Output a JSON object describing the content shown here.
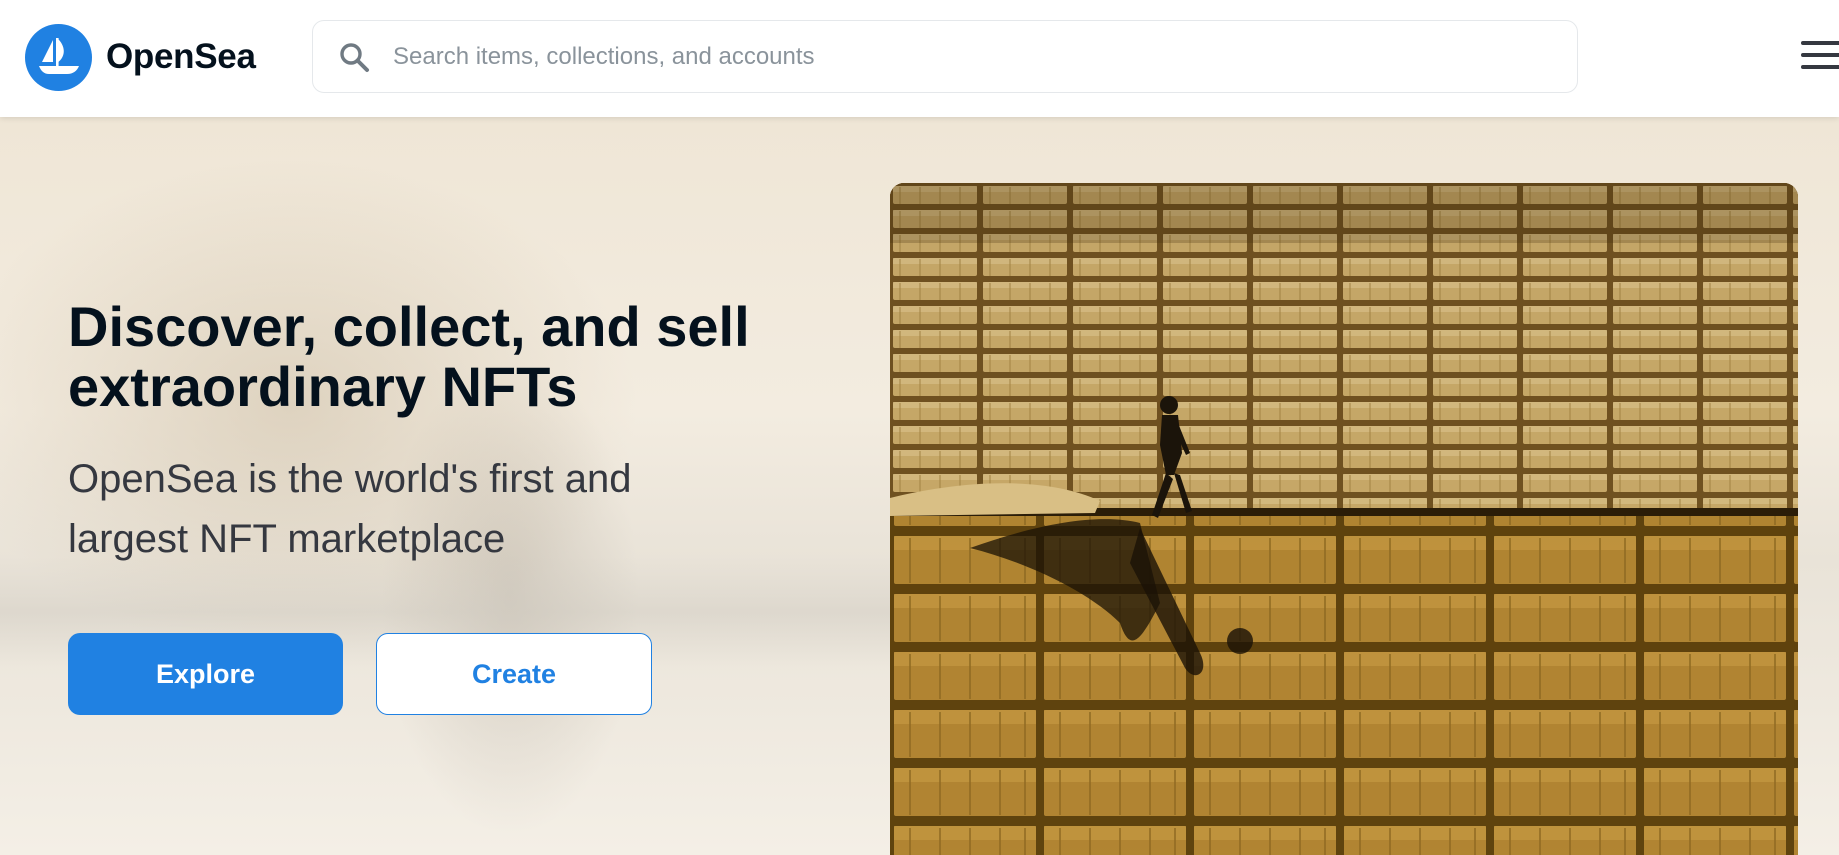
{
  "header": {
    "brand_name": "OpenSea",
    "search_placeholder": "Search items, collections, and accounts"
  },
  "hero": {
    "headline_line1": "Discover, collect, and sell",
    "headline_line2": "extraordinary NFTs",
    "subline_line1": "OpenSea is the world's first and",
    "subline_line2": "largest NFT marketplace",
    "explore_label": "Explore",
    "create_label": "Create"
  },
  "colors": {
    "accent": "#2081e2",
    "heading": "#04111d",
    "body_text": "#353840",
    "placeholder": "#8a939b"
  },
  "icons": {
    "logo": "boat-logo-icon",
    "search": "search-icon",
    "menu": "hamburger-menu-icon"
  }
}
